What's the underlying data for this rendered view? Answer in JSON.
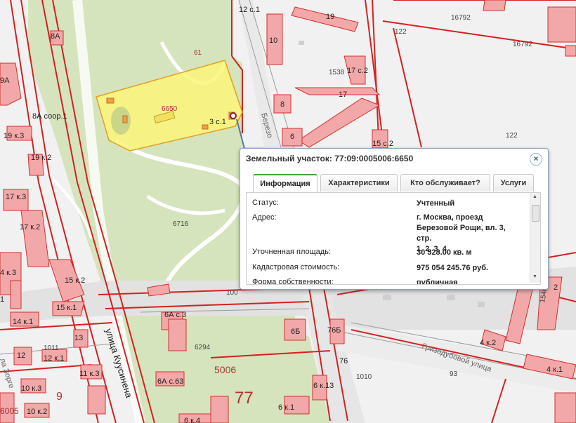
{
  "map": {
    "labels": {
      "b12s1": "12 с.1",
      "b19": "19",
      "b16792a": "16792",
      "b16792b": "16792",
      "b122a": "122",
      "b122b": "122",
      "b8a": "8А",
      "b10": "10",
      "b61": "61",
      "b1538": "1538",
      "b17s2": "17 с.2",
      "b9a": "9А",
      "b6650": "6650",
      "b17": "17",
      "b8": "8",
      "b8a_soor": "8А соор.1",
      "b3s1": "3 с.1",
      "b6": "6",
      "b15s2": "15 с.2",
      "b19k3": "19 к.3",
      "b19k2": "19 к.2",
      "b17k3": "17 к.3",
      "b17k2": "17 к.2",
      "b6716": "6716",
      "b4k3": "4 к.3",
      "b15k2": "15 к.2",
      "b15k1": "15 к.1",
      "b14k1": "14 к.1",
      "b1": "1",
      "b100": "100",
      "b6as3": "6А с.3",
      "b6b": "6Б",
      "b76b": "76Б",
      "b13": "13",
      "b1011": "1011",
      "b12": "12",
      "b12k1": "12 к.1",
      "b6294": "6294",
      "b76": "76",
      "b1010": "1010",
      "b11k3": "11 к.3",
      "b5006": "5006",
      "b6as63": "6А с.63",
      "b6k13": "6 к.13",
      "b10k3": "10 к.3",
      "b9": "9",
      "b10k2": "10 к.2",
      "b6005": "6005",
      "b77": "77",
      "b6k1": "6 к.1",
      "b6k4": "6 к.4",
      "b4k2": "4 к.2",
      "b4k1": "4 к.1",
      "b93": "93",
      "b2": "2",
      "b1540": "1540"
    },
    "streets": {
      "kusinena": "улица Куусинена",
      "berezovoy": "Березо",
      "grizodubovoy": "Гризодубовой улица",
      "zorge": "ла Зорге"
    }
  },
  "popup": {
    "title": "Земельный участок: 77:09:0005006:6650",
    "close": "×",
    "tabs": [
      {
        "label": "Информация",
        "active": true
      },
      {
        "label": "Характеристики",
        "active": false
      },
      {
        "label": "Кто обслуживает?",
        "active": false
      },
      {
        "label": "Услуги",
        "active": false
      }
    ],
    "rows": [
      {
        "label": "Статус:",
        "value": "Учтенный"
      },
      {
        "label": "Адрес:",
        "value_lines": [
          "г. Москва, проезд",
          "Березовой Рощи, вл. 3, стр.",
          "1, 2, 3, 4"
        ]
      },
      {
        "label": "Уточненная площадь:",
        "value": "30 528.00 кв. м"
      },
      {
        "label": "Кадастровая стоимость:",
        "value": "975 054 245.76 руб."
      },
      {
        "label": "Форма собственности:",
        "value": "публичная"
      }
    ]
  },
  "colors": {
    "parcel_highlight": "#fbf57a",
    "building": "#f2a8a8",
    "park": "#d8e6c0",
    "boundary": "#d62020"
  },
  "icons": [
    "close-icon",
    "scroll-up-icon",
    "scroll-down-icon",
    "marker-icon"
  ]
}
